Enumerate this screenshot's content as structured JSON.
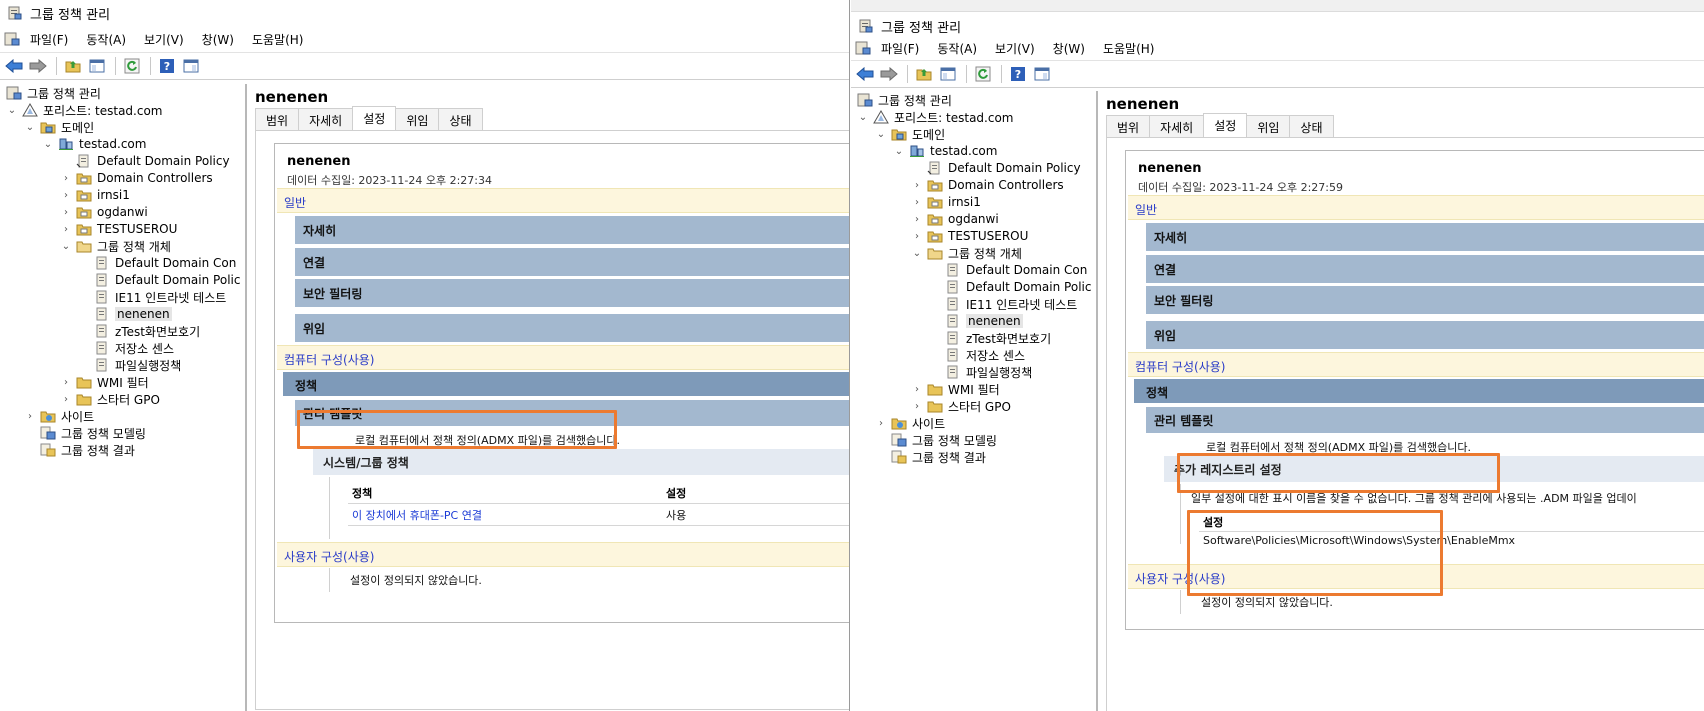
{
  "left": {
    "title": "그룹 정책 관리",
    "menu": [
      "파일(F)",
      "동작(A)",
      "보기(V)",
      "창(W)",
      "도움말(H)"
    ],
    "tree": {
      "root": "그룹 정책 관리",
      "forest": "포리스트: testad.com",
      "domains": "도메인",
      "domain": "testad.com",
      "items": [
        "Default Domain Policy",
        "Domain Controllers",
        "irnsi1",
        "ogdanwi",
        "TESTUSEROU"
      ],
      "gpo_container": "그룹 정책 개체",
      "gpos": [
        "Default Domain Con",
        "Default Domain Polic",
        "IE11 인트라넷 테스트",
        "nenenen",
        "zTest화면보호기",
        "저장소 센스",
        "파일실행정책"
      ],
      "wmi": "WMI 필터",
      "starter": "스타터 GPO",
      "sites": "사이트",
      "modeling": "그룹 정책 모델링",
      "results": "그룹 정책 결과"
    },
    "detail": {
      "title": "nenenen",
      "tabs": [
        "범위",
        "자세히",
        "설정",
        "위임",
        "상태"
      ],
      "gpo_name": "nenenen",
      "collected": "데이터 수집일: 2023-11-24 오후 2:27:34",
      "general": "일반",
      "sections": [
        "자세히",
        "연결",
        "보안 필터링",
        "위임"
      ],
      "computer_config": "컴퓨터 구성(사용)",
      "policies": "정책",
      "admin_templates": "관리 템플릿",
      "admx_notice": "로컬 컴퓨터에서 정책 정의(ADMX 파일)를 검색했습니다.",
      "subcategory": "시스템/그룹 정책",
      "table_headers": [
        "정책",
        "설정"
      ],
      "table_rows": [
        {
          "policy": "이 장치에서 휴대폰-PC 연결",
          "setting": "사용"
        }
      ],
      "user_config": "사용자 구성(사용)",
      "no_settings": "설정이 정의되지 않았습니다."
    }
  },
  "right": {
    "title": "그룹 정책 관리",
    "menu": [
      "파일(F)",
      "동작(A)",
      "보기(V)",
      "창(W)",
      "도움말(H)"
    ],
    "tree": {
      "root": "그룹 정책 관리",
      "forest": "포리스트: testad.com",
      "domains": "도메인",
      "domain": "testad.com",
      "items": [
        "Default Domain Policy",
        "Domain Controllers",
        "irnsi1",
        "ogdanwi",
        "TESTUSEROU"
      ],
      "gpo_container": "그룹 정책 개체",
      "gpos": [
        "Default Domain Con",
        "Default Domain Polic",
        "IE11 인트라넷 테스트",
        "nenenen",
        "zTest화면보호기",
        "저장소 센스",
        "파일실행정책"
      ],
      "wmi": "WMI 필터",
      "starter": "스타터 GPO",
      "sites": "사이트",
      "modeling": "그룹 정책 모델링",
      "results": "그룹 정책 결과"
    },
    "detail": {
      "title": "nenenen",
      "tabs": [
        "범위",
        "자세히",
        "설정",
        "위임",
        "상태"
      ],
      "gpo_name": "nenenen",
      "collected": "데이터 수집일: 2023-11-24 오후 2:27:59",
      "general": "일반",
      "sections": [
        "자세히",
        "연결",
        "보안 필터링",
        "위임"
      ],
      "computer_config": "컴퓨터 구성(사용)",
      "policies": "정책",
      "admin_templates": "관리 템플릿",
      "admx_notice": "로컬 컴퓨터에서 정책 정의(ADMX 파일)를 검색했습니다.",
      "subcategory": "추가 레지스트리 설정",
      "extra_notice": "일부 설정에 대한 표시 이름을 찾을 수 없습니다. 그룹 정책 관리에 사용되는 .ADM 파일을 업데이",
      "settings_header": "설정",
      "registry_path": "Software\\Policies\\Microsoft\\Windows\\System\\EnableMmx",
      "user_config": "사용자 구성(사용)",
      "no_settings": "설정이 정의되지 않았습니다."
    }
  },
  "colors": {
    "highlight_box": "#ec7a30",
    "section_header_bg": "#fdf6dd",
    "section_header_text": "#2a3cc8",
    "bar_blue": "#a3b8cf",
    "bar_dark": "#7e9ab9",
    "link": "#1a3ad6"
  }
}
